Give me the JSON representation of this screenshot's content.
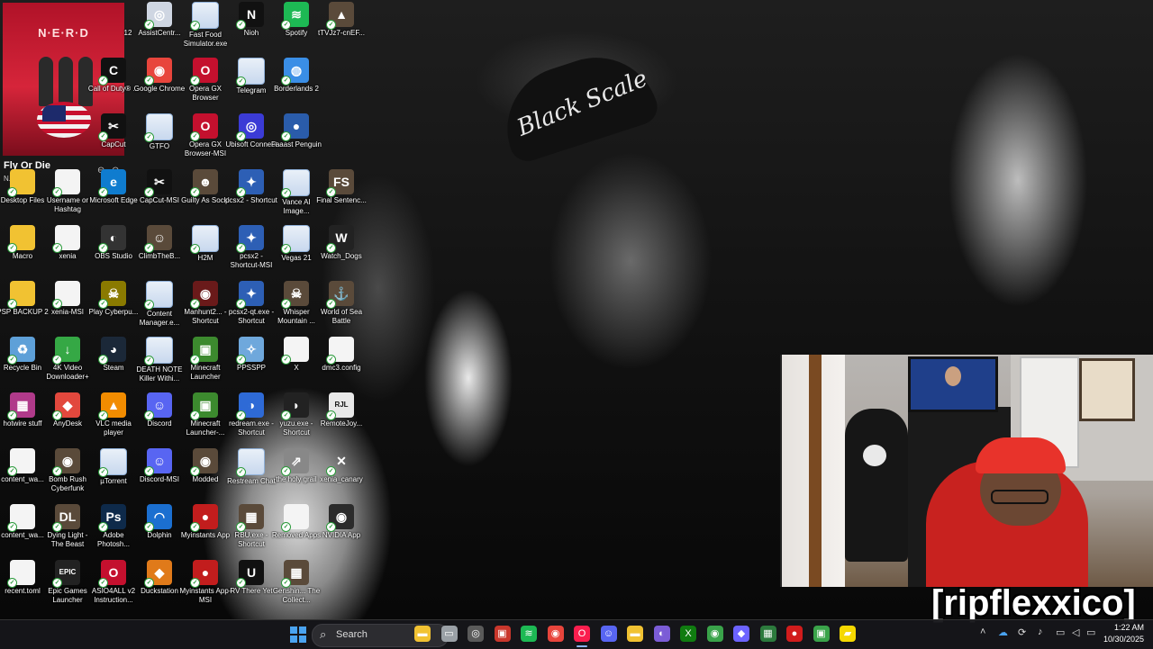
{
  "media": {
    "band_text": "N·E·R·D",
    "title": "Fly Or Die",
    "artist": "N.E.R.D",
    "prev_icon": "⊖",
    "next_icon": "⊙"
  },
  "wallpaper": {
    "cap_text": "Black Scale"
  },
  "desktop_icons": [
    {
      "label": "12",
      "icon": "partial-icon"
    },
    {
      "label": "AssistCentr...",
      "icon": "assist-icon",
      "glyph": "◎"
    },
    {
      "label": "Fast Food Simulator.exe",
      "icon": "window-file-icon",
      "glyph": ""
    },
    {
      "label": "Nioh",
      "icon": "nioh-icon",
      "glyph": "N"
    },
    {
      "label": "Spotify",
      "icon": "spotify-icon",
      "glyph": "≋"
    },
    {
      "label": "tTVJz7-cnEF...",
      "icon": "game-icon",
      "glyph": "▲"
    },
    {
      "label": "Call of Duty® ...",
      "icon": "cod-icon",
      "glyph": "C"
    },
    {
      "label": "Google Chrome",
      "icon": "chrome-icon",
      "glyph": "◉"
    },
    {
      "label": "Opera GX Browser",
      "icon": "opera-gx-icon",
      "glyph": "O"
    },
    {
      "label": "Telegram",
      "icon": "window-file-icon",
      "glyph": ""
    },
    {
      "label": "Borderlands 2",
      "icon": "globe-icon",
      "glyph": "◍"
    },
    {
      "label": "CapCut",
      "icon": "capcut-icon",
      "glyph": "✂"
    },
    {
      "label": "GTFO",
      "icon": "window-file-icon",
      "glyph": ""
    },
    {
      "label": "Opera GX Browser-MSI",
      "icon": "opera-gx-icon",
      "glyph": "O"
    },
    {
      "label": "Ubisoft Connect",
      "icon": "ubisoft-icon",
      "glyph": "◎"
    },
    {
      "label": "Faaast Penguin",
      "icon": "penguin-icon",
      "glyph": "●"
    },
    {
      "label": "Desktop Files",
      "icon": "folder-icon",
      "glyph": ""
    },
    {
      "label": "Username or Hashtag",
      "icon": "document-icon",
      "glyph": ""
    },
    {
      "label": "Microsoft Edge",
      "icon": "edge-icon",
      "glyph": "e"
    },
    {
      "label": "CapCut-MSI",
      "icon": "capcut-icon",
      "glyph": "✂"
    },
    {
      "label": "Guilty As Sock!",
      "icon": "game-icon",
      "glyph": "☻"
    },
    {
      "label": "pcsx2 - Shortcut",
      "icon": "pcsx2-icon",
      "glyph": "✦"
    },
    {
      "label": "Vance AI Image...",
      "icon": "window-file-icon",
      "glyph": ""
    },
    {
      "label": "Final Sentenc...",
      "icon": "game-icon",
      "glyph": "FS"
    },
    {
      "label": "Macro",
      "icon": "folder-icon",
      "glyph": ""
    },
    {
      "label": "xenia",
      "icon": "document-icon",
      "glyph": ""
    },
    {
      "label": "OBS Studio",
      "icon": "obs-icon",
      "glyph": "◐"
    },
    {
      "label": "ClimbTheB...",
      "icon": "game-icon",
      "glyph": "☺"
    },
    {
      "label": "H2M",
      "icon": "window-file-icon",
      "glyph": ""
    },
    {
      "label": "pcsx2 - Shortcut-MSI",
      "icon": "pcsx2-icon",
      "glyph": "✦"
    },
    {
      "label": "Vegas 21",
      "icon": "window-file-icon",
      "glyph": ""
    },
    {
      "label": "Watch_Dogs",
      "icon": "watchdogs-icon",
      "glyph": "W"
    },
    {
      "label": "PSP BACKUP 2",
      "icon": "folder-icon",
      "glyph": ""
    },
    {
      "label": "xenia-MSI",
      "icon": "document-icon",
      "glyph": ""
    },
    {
      "label": "Play Cyberpu...",
      "icon": "cyberpunk-icon",
      "glyph": "☠"
    },
    {
      "label": "Content Manager.e...",
      "icon": "window-file-icon",
      "glyph": ""
    },
    {
      "label": "Manhunt2... - Shortcut",
      "icon": "manhunt-icon",
      "glyph": "◉"
    },
    {
      "label": "pcsx2-qt.exe - Shortcut",
      "icon": "pcsx2-icon",
      "glyph": "✦"
    },
    {
      "label": "Whisper Mountain ...",
      "icon": "game-icon",
      "glyph": "☠"
    },
    {
      "label": "World of Sea Battle",
      "icon": "game-icon",
      "glyph": "⚓"
    },
    {
      "label": "Recycle Bin",
      "icon": "recycle-bin-icon",
      "glyph": "♻"
    },
    {
      "label": "4K Video Downloader+",
      "icon": "download-icon",
      "glyph": "↓"
    },
    {
      "label": "Steam",
      "icon": "steam-icon",
      "glyph": "◕"
    },
    {
      "label": "DEATH NOTE Killer Withi...",
      "icon": "window-file-icon",
      "glyph": ""
    },
    {
      "label": "Minecraft Launcher",
      "icon": "minecraft-icon",
      "glyph": "▣"
    },
    {
      "label": "PPSSPP",
      "icon": "ppsspp-icon",
      "glyph": "✧"
    },
    {
      "label": "X",
      "icon": "document-icon",
      "glyph": ""
    },
    {
      "label": "dmc3.config",
      "icon": "document-icon",
      "glyph": ""
    },
    {
      "label": "hotwire stuff",
      "icon": "archive-icon",
      "glyph": "▦"
    },
    {
      "label": "AnyDesk",
      "icon": "anydesk-icon",
      "glyph": "◆"
    },
    {
      "label": "VLC media player",
      "icon": "vlc-icon",
      "glyph": "▲"
    },
    {
      "label": "Discord",
      "icon": "discord-icon",
      "glyph": "☺"
    },
    {
      "label": "Minecraft Launcher-...",
      "icon": "minecraft-icon",
      "glyph": "▣"
    },
    {
      "label": "redream.exe - Shortcut",
      "icon": "redream-icon",
      "glyph": "◑"
    },
    {
      "label": "yuzu.exe - Shortcut",
      "icon": "yuzu-icon",
      "glyph": "◗"
    },
    {
      "label": "RemoteJoy...",
      "icon": "remotejoy-icon",
      "glyph": "RJL"
    },
    {
      "label": "content_wa...",
      "icon": "document-icon",
      "glyph": ""
    },
    {
      "label": "Bomb Rush Cyberfunk",
      "icon": "game-icon",
      "glyph": "◉"
    },
    {
      "label": "µTorrent",
      "icon": "window-file-icon",
      "glyph": ""
    },
    {
      "label": "Discord-MSI",
      "icon": "discord-icon",
      "glyph": "☺"
    },
    {
      "label": "Modded",
      "icon": "game-icon",
      "glyph": "◉"
    },
    {
      "label": "Restream Chat",
      "icon": "window-file-icon",
      "glyph": ""
    },
    {
      "label": "the holy grail",
      "icon": "shortcut-icon",
      "glyph": "⇗"
    },
    {
      "label": "xenia_canary",
      "icon": "xenia-icon",
      "glyph": "✕"
    },
    {
      "label": "content_wa...",
      "icon": "document-icon",
      "glyph": ""
    },
    {
      "label": "Dying Light - The Beast",
      "icon": "game-icon",
      "glyph": "DL"
    },
    {
      "label": "Adobe Photosh...",
      "icon": "photoshop-icon",
      "glyph": "Ps"
    },
    {
      "label": "Dolphin",
      "icon": "dolphin-icon",
      "glyph": "◠"
    },
    {
      "label": "Myinstants App",
      "icon": "myinstants-icon",
      "glyph": "●"
    },
    {
      "label": "RBU.exe - Shortcut",
      "icon": "game-icon",
      "glyph": "▦"
    },
    {
      "label": "Removed Apps",
      "icon": "document-icon",
      "glyph": ""
    },
    {
      "label": "NVIDIA App",
      "icon": "nvidia-icon",
      "glyph": "◉"
    },
    {
      "label": "recent.toml",
      "icon": "document-icon",
      "glyph": ""
    },
    {
      "label": "Epic Games Launcher",
      "icon": "epic-icon",
      "glyph": "EPIC"
    },
    {
      "label": "ASIO4ALL v2 Instruction...",
      "icon": "opera-icon",
      "glyph": "O"
    },
    {
      "label": "Duckstation",
      "icon": "duckstation-icon",
      "glyph": "◆"
    },
    {
      "label": "Myinstants App-MSI",
      "icon": "myinstants-icon",
      "glyph": "●"
    },
    {
      "label": "RV There Yet",
      "icon": "unreal-icon",
      "glyph": "U"
    },
    {
      "label": "Genshin... The Collect...",
      "icon": "game-icon",
      "glyph": "▦"
    }
  ],
  "stream": {
    "name": "[ripflexxico]"
  },
  "taskbar": {
    "search_label": "Search",
    "search_icon": "⌕",
    "apps": [
      {
        "name": "taskbar-file-explorer-icon",
        "glyph": "▬",
        "color": "#f1c232"
      },
      {
        "name": "taskbar-task-view-icon",
        "glyph": "▭",
        "color": "#9aa0a6"
      },
      {
        "name": "taskbar-chatgpt-icon",
        "glyph": "◎",
        "color": "#5a5a5a"
      },
      {
        "name": "taskbar-app-icon",
        "glyph": "▣",
        "color": "#c9372c"
      },
      {
        "name": "taskbar-spotify-icon",
        "glyph": "≋",
        "color": "#1db954"
      },
      {
        "name": "taskbar-chrome-icon",
        "glyph": "◉",
        "color": "#e8453c"
      },
      {
        "name": "taskbar-opera-gx-icon",
        "glyph": "O",
        "color": "#fa1e4e"
      },
      {
        "name": "taskbar-discord-icon",
        "glyph": "☺",
        "color": "#5865f2"
      },
      {
        "name": "taskbar-folder-icon",
        "glyph": "▬",
        "color": "#f1c232"
      },
      {
        "name": "taskbar-obs-icon",
        "glyph": "◐",
        "color": "#7b5cd6"
      },
      {
        "name": "taskbar-xbox-icon",
        "glyph": "X",
        "color": "#107c10"
      },
      {
        "name": "taskbar-app-green-icon",
        "glyph": "◉",
        "color": "#3aa34a"
      },
      {
        "name": "taskbar-controller-icon",
        "glyph": "◆",
        "color": "#6c63ff"
      },
      {
        "name": "taskbar-game-icon",
        "glyph": "▦",
        "color": "#2c7a3d"
      },
      {
        "name": "taskbar-record-icon",
        "glyph": "●",
        "color": "#d11c1c"
      },
      {
        "name": "taskbar-app2-icon",
        "glyph": "▣",
        "color": "#3aa34a"
      },
      {
        "name": "taskbar-notes-icon",
        "glyph": "▰",
        "color": "#f5d800"
      }
    ],
    "tray": {
      "chevron": "˄",
      "time": "1:22 AM",
      "date": "10/30/2025"
    }
  }
}
